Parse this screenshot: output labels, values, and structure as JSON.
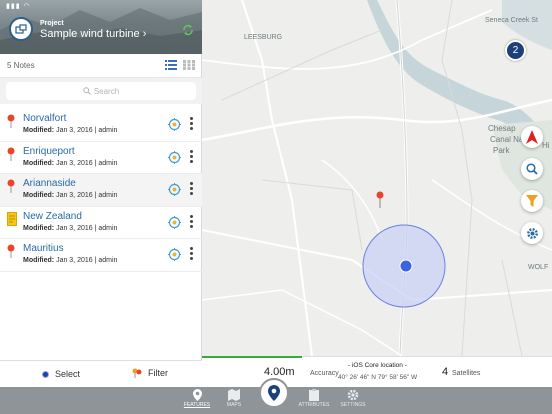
{
  "project": {
    "label": "Project",
    "name": "Sample wind turbine",
    "chevron": "›"
  },
  "notes_bar": {
    "count": "5 Notes"
  },
  "search": {
    "placeholder": "Search"
  },
  "notes": [
    {
      "title": "Norvalfort",
      "modified_label": "Modified:",
      "modified_value": "Jan 3, 2016 | admin",
      "icon": "pin-icon"
    },
    {
      "title": "Enriqueport",
      "modified_label": "Modified:",
      "modified_value": "Jan 3, 2016 | admin",
      "icon": "pin-icon"
    },
    {
      "title": "Ariannaside",
      "modified_label": "Modified:",
      "modified_value": "Jan 3, 2016 | admin",
      "icon": "pin-icon"
    },
    {
      "title": "New Zealand",
      "modified_label": "Modified:",
      "modified_value": "Jan 3, 2016 | admin",
      "icon": "note-icon"
    },
    {
      "title": "Mauritius",
      "modified_label": "Modified:",
      "modified_value": "Jan 3, 2016 | admin",
      "icon": "pin-icon"
    }
  ],
  "footer": {
    "select": "Select",
    "filter": "Filter"
  },
  "map": {
    "cluster_count": "2",
    "labels": {
      "leesburg": "LEESBURG",
      "seneca": "Seneca Creek St",
      "chesap": "Chesap",
      "canal": "Canal Nat",
      "park": "Park",
      "hi": "Hi",
      "wolf": "WOLF"
    }
  },
  "gps": {
    "accuracy_value": "4.00m",
    "accuracy_label": "Accuracy",
    "location_title": "- iOS Core location -",
    "coords": "40° 26' 46\" N 79° 58' 56\" W",
    "satellites_value": "4",
    "satellites_label": "Satellites"
  },
  "tabs": [
    {
      "label": "FEATURES",
      "active": true
    },
    {
      "label": "MAPS",
      "active": false
    },
    {
      "label": "ATTRIBUTES",
      "active": false
    },
    {
      "label": "SETTINGS",
      "active": false
    }
  ],
  "colors": {
    "link": "#2a6aa8",
    "cluster": "#1d3f7a",
    "accuracy_fill": "#c9d2f5",
    "location_dot": "#3c63e0",
    "gps_progress": "#3aaa3a"
  }
}
